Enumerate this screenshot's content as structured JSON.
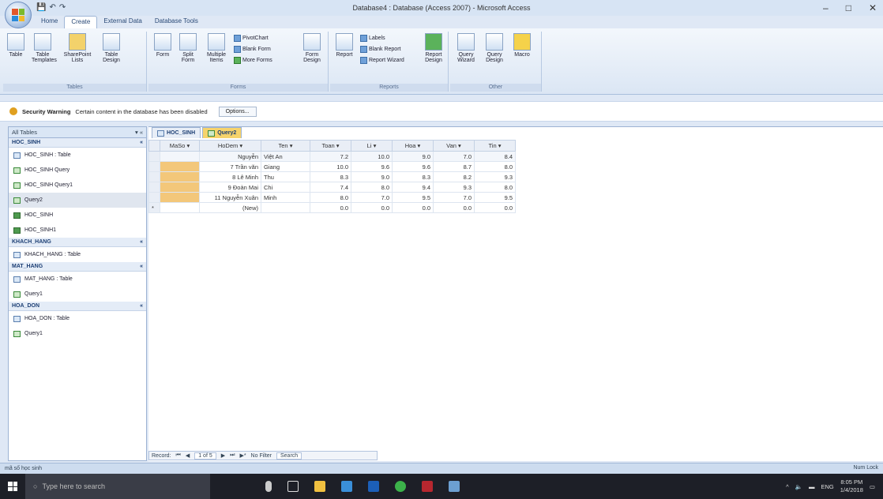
{
  "window": {
    "title": "Database4 : Database (Access 2007) - Microsoft Access",
    "minimize": "–",
    "maximize": "□",
    "close": "✕"
  },
  "ribbon_tabs": [
    "Home",
    "Create",
    "External Data",
    "Database Tools"
  ],
  "ribbon": {
    "tables": {
      "title": "Tables",
      "table": "Table",
      "table_templates": "Table Templates",
      "sharepoint_lists": "SharePoint Lists",
      "table_design": "Table Design"
    },
    "forms": {
      "title": "Forms",
      "form": "Form",
      "split_form": "Split Form",
      "multiple_items": "Multiple Items",
      "pivotchart": "PivotChart",
      "blank_form": "Blank Form",
      "more_forms": "More Forms",
      "form_design": "Form Design"
    },
    "reports": {
      "title": "Reports",
      "report": "Report",
      "labels": "Labels",
      "blank_report": "Blank Report",
      "report_wizard": "Report Wizard",
      "report_design": "Report Design"
    },
    "other": {
      "title": "Other",
      "query_wizard": "Query Wizard",
      "query_design": "Query Design",
      "macro": "Macro"
    }
  },
  "security": {
    "label": "Security Warning",
    "message": "Certain content in the database has been disabled",
    "options": "Options..."
  },
  "nav": {
    "header": "All Tables",
    "groups": [
      {
        "name": "HOC_SINH",
        "items": [
          {
            "label": "HOC_SINH : Table",
            "kind": "table"
          },
          {
            "label": "HOC_SINH Query",
            "kind": "query"
          },
          {
            "label": "HOC_SINH Query1",
            "kind": "query"
          },
          {
            "label": "Query2",
            "kind": "query",
            "selected": true
          },
          {
            "label": "HOC_SINH",
            "kind": "form"
          },
          {
            "label": "HOC_SINH1",
            "kind": "form"
          }
        ]
      },
      {
        "name": "KHACH_HANG",
        "items": [
          {
            "label": "KHACH_HANG : Table",
            "kind": "table"
          }
        ]
      },
      {
        "name": "MAT_HANG",
        "items": [
          {
            "label": "MAT_HANG : Table",
            "kind": "table"
          },
          {
            "label": "Query1",
            "kind": "query"
          }
        ]
      },
      {
        "name": "HOA_DON",
        "items": [
          {
            "label": "HOA_DON : Table",
            "kind": "table"
          },
          {
            "label": "Query1",
            "kind": "query"
          }
        ]
      }
    ]
  },
  "doc_tabs": [
    "HOC_SINH",
    "Query2"
  ],
  "grid": {
    "columns": [
      "MaSo",
      "HoDem",
      "Ten",
      "Toan",
      "Li",
      "Hoa",
      "Van",
      "Tin"
    ],
    "rows": [
      [
        "",
        "Nguyễn",
        "Việt An",
        "7.2",
        "10.0",
        "9.0",
        "7.0",
        "8.4"
      ],
      [
        "",
        "7 Trần văn",
        "Giang",
        "10.0",
        "9.6",
        "9.6",
        "8.7",
        "8.0"
      ],
      [
        "",
        "8 Lê Minh",
        "Thu",
        "8.3",
        "9.0",
        "8.3",
        "8.2",
        "9.3"
      ],
      [
        "",
        "9 Đoàn Mai",
        "Chi",
        "7.4",
        "8.0",
        "9.4",
        "9.3",
        "8.0"
      ],
      [
        "",
        "11 Nguyễn Xuân",
        "Minh",
        "8.0",
        "7.0",
        "9.5",
        "7.0",
        "9.5"
      ]
    ],
    "new_row": [
      "",
      "(New)",
      "",
      "0.0",
      "0.0",
      "0.0",
      "0.0",
      "0.0"
    ]
  },
  "record_nav": {
    "label": "Record:",
    "position": "1 of 5",
    "filter": "No Filter",
    "search": "Search"
  },
  "status": {
    "left": "mã số học sinh",
    "right": "Num Lock"
  },
  "taskbar": {
    "search_placeholder": "Type here to search",
    "lang": "ENG",
    "time": "8:05 PM",
    "date": "1/4/2018"
  }
}
